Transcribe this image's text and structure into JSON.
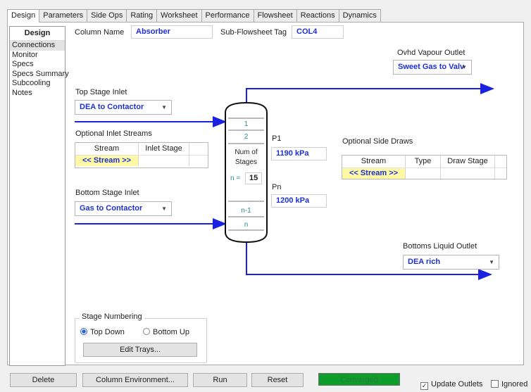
{
  "tabs": [
    "Design",
    "Parameters",
    "Side Ops",
    "Rating",
    "Worksheet",
    "Performance",
    "Flowsheet",
    "Reactions",
    "Dynamics"
  ],
  "nav": {
    "title": "Design",
    "items": [
      "Connections",
      "Monitor",
      "Specs",
      "Specs Summary",
      "Subcooling",
      "Notes"
    ]
  },
  "header": {
    "column_name_label": "Column Name",
    "column_name_value": "Absorber",
    "subflowsheet_label": "Sub-Flowsheet Tag",
    "subflowsheet_value": "COL4"
  },
  "top_stage_inlet": {
    "label": "Top Stage Inlet",
    "value": "DEA to Contactor"
  },
  "optional_inlets": {
    "label": "Optional Inlet Streams",
    "headers": [
      "Stream",
      "Inlet Stage"
    ],
    "placeholder": "<< Stream >>"
  },
  "bottom_stage_inlet": {
    "label": "Bottom Stage Inlet",
    "value": "Gas to Contactor"
  },
  "column": {
    "stage1": "1",
    "stage2": "2",
    "num_stages_label1": "Num of",
    "num_stages_label2": "Stages",
    "n_label": "n =",
    "n_value": "15",
    "stage_nm1": "n-1",
    "stage_n": "n"
  },
  "pressures": {
    "p1_label": "P1",
    "p1_value": "1190 kPa",
    "pn_label": "Pn",
    "pn_value": "1200 kPa"
  },
  "ovhd": {
    "label": "Ovhd Vapour Outlet",
    "value": "Sweet Gas to Valv"
  },
  "side_draws": {
    "label": "Optional Side Draws",
    "headers": [
      "Stream",
      "Type",
      "Draw Stage"
    ],
    "placeholder": "<< Stream >>"
  },
  "bottoms": {
    "label": "Bottoms Liquid Outlet",
    "value": "DEA rich"
  },
  "stage_numbering": {
    "label": "Stage Numbering",
    "top_down": "Top Down",
    "bottom_up": "Bottom Up",
    "edit_trays": "Edit Trays...",
    "selected": "Top Down"
  },
  "footer": {
    "delete": "Delete",
    "column_env": "Column Environment...",
    "run": "Run",
    "reset": "Reset",
    "status": "Converged",
    "update_outlets": "Update Outlets",
    "update_outlets_checked": true,
    "ignored": "Ignored",
    "ignored_checked": false
  },
  "colors": {
    "stream_arrow": "#1a22e0",
    "status_bg": "#0c9d2a",
    "value_text": "#1c2fd6"
  }
}
